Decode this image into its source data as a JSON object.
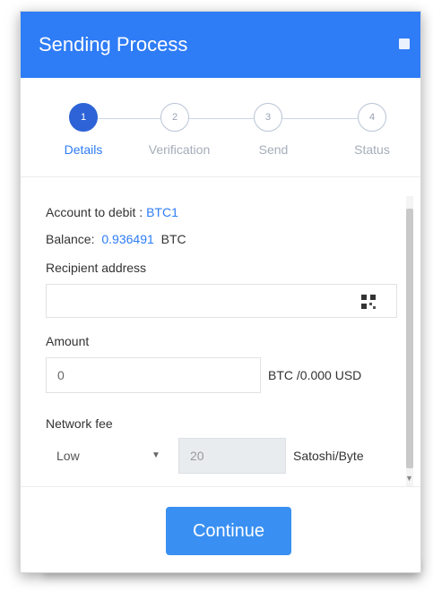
{
  "modal": {
    "title": "Sending Process",
    "close_icon": "close-icon"
  },
  "steps": [
    {
      "number": "1",
      "label": "Details",
      "active": true
    },
    {
      "number": "2",
      "label": "Verification",
      "active": false
    },
    {
      "number": "3",
      "label": "Send",
      "active": false
    },
    {
      "number": "4",
      "label": "Status",
      "active": false
    }
  ],
  "form": {
    "account_label": "Account to debit :",
    "account_value": "BTC1",
    "balance_label": "Balance:",
    "balance_value": "0.936491",
    "balance_unit": "BTC",
    "recipient_label": "Recipient address",
    "recipient_value": "",
    "qr_icon": "qr-code-icon",
    "amount_label": "Amount",
    "amount_value": "0",
    "amount_unit": "BTC /0.000 USD",
    "fee_label": "Network fee",
    "fee_level": "Low",
    "fee_value": "20",
    "fee_unit": "Satoshi/Byte"
  },
  "actions": {
    "continue_label": "Continue"
  },
  "colors": {
    "header_bg": "#2e7cf6",
    "active_step": "#2d63d6",
    "accent_text": "#2e7cf6",
    "continue_bg": "#3a90f2"
  }
}
